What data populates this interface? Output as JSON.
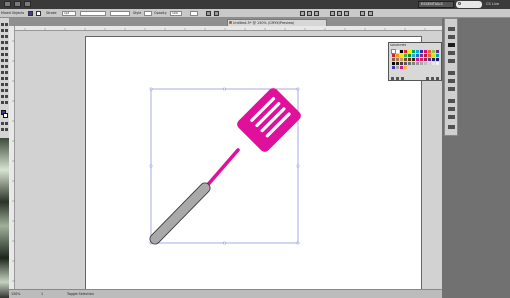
{
  "app": {
    "workspace": "ESSENTIALS",
    "user": "CS Live"
  },
  "control_bar": {
    "selection_label": "Mixed Objects",
    "stroke_label": "Stroke",
    "stroke_value": "1pt",
    "style_label": "Style",
    "opacity_label": "Opacity",
    "opacity_value": "100"
  },
  "document": {
    "tab_title": "Untitled-5* @ 150% (CMYK/Preview)"
  },
  "status_bar": {
    "zoom": "150%",
    "page": "1",
    "tool": "Toggle Selection"
  },
  "swatches_panel": {
    "tab_label": "SWATCHES"
  },
  "colors": {
    "spatula_head": "#e0109c",
    "spatula_handle": "#a9a9a9",
    "selection_box": "#6e74d6",
    "fill_swatch": "#3b3aa8"
  }
}
